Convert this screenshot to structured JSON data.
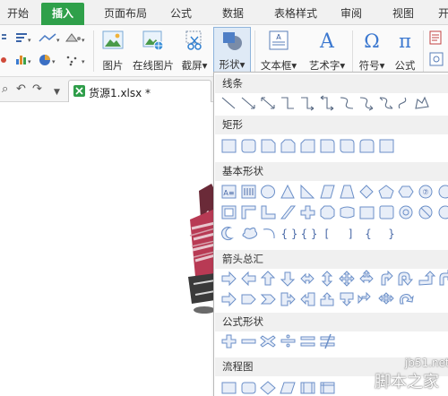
{
  "ribbon_tabs": [
    "开始",
    "插入",
    "页面布局",
    "公式",
    "数据",
    "表格样式",
    "审阅",
    "视图",
    "开"
  ],
  "ribbon": {
    "picture": "图片",
    "online_picture": "在线图片",
    "screenshot": "截屏",
    "shapes": "形状",
    "textbox": "文本框",
    "wordart": "艺术字",
    "symbol": "符号",
    "formula": "公式",
    "dropdown_marker": "▾"
  },
  "document": {
    "tab_name": "货源1.xlsx *"
  },
  "shapes_panel": {
    "sections": [
      "线条",
      "矩形",
      "基本形状",
      "箭头总汇",
      "公式形状",
      "流程图"
    ],
    "text_glyphs": {
      "basic_text": "A≡",
      "clock": "⑦",
      "brace_pair": "{ }",
      "left_brace": "{",
      "right_brace": "}",
      "left_bracket": "[",
      "right_bracket": "]"
    }
  },
  "watermark": {
    "line1": "jb51.net",
    "line2": "脚本之家"
  },
  "colors": {
    "active_tab": "#2fa04a",
    "shape_stroke": "#6b8fc8",
    "shape_fill": "#e8eef8"
  }
}
